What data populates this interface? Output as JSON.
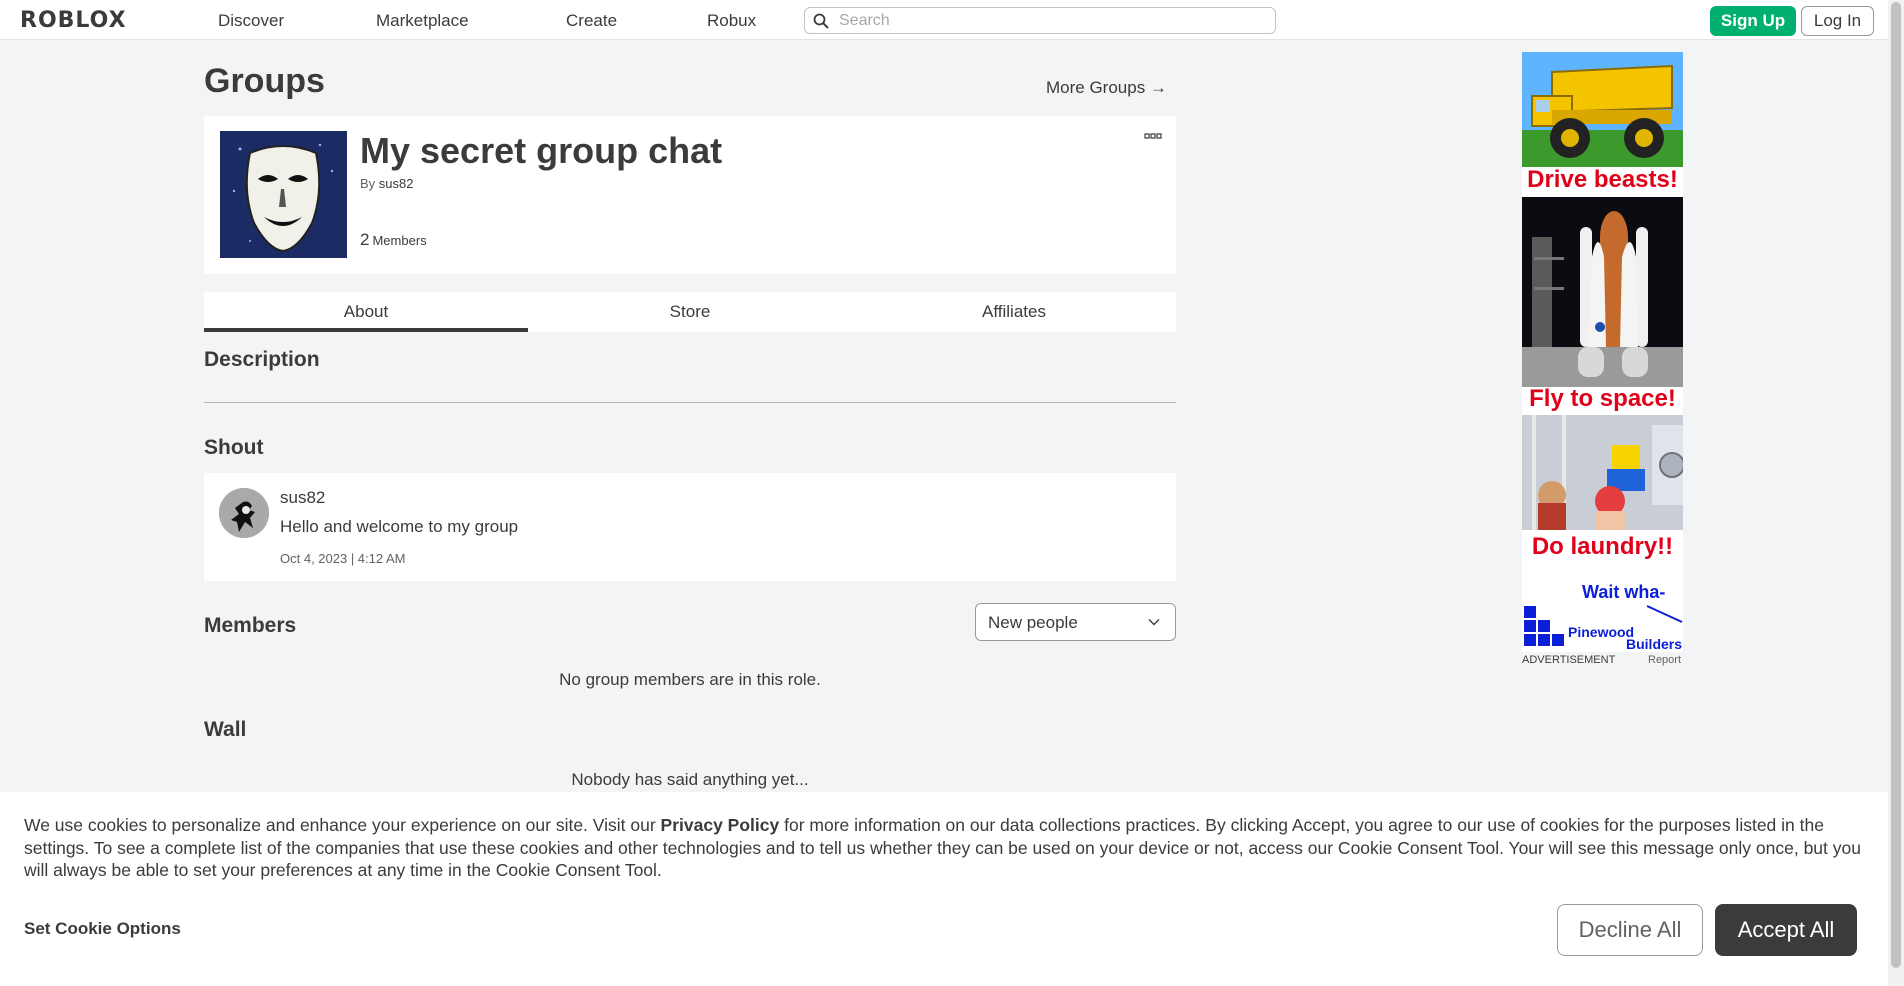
{
  "nav": {
    "logo": "ROBLOX",
    "links": [
      "Discover",
      "Marketplace",
      "Create",
      "Robux"
    ],
    "search_placeholder": "Search",
    "signup_label": "Sign Up",
    "login_label": "Log In"
  },
  "page": {
    "title": "Groups",
    "more_groups": "More Groups →"
  },
  "group": {
    "name": "My secret group chat",
    "by_prefix": "By",
    "owner": "sus82",
    "member_count": "2",
    "member_label": "Members"
  },
  "tabs": [
    "About",
    "Store",
    "Affiliates"
  ],
  "sections": {
    "description": "Description",
    "shout": "Shout",
    "members": "Members",
    "wall": "Wall"
  },
  "shout": {
    "user": "sus82",
    "text": "Hello and welcome to my group",
    "time": "Oct 4, 2023 | 4:12 AM"
  },
  "members": {
    "role_selected": "New people",
    "empty": "No group members are in this role."
  },
  "wall": {
    "empty": "Nobody has said anything yet..."
  },
  "ad": {
    "captions": [
      "Drive beasts!",
      "Fly to space!",
      "Do laundry!!"
    ],
    "tagline": "Wait wha-",
    "brand_line1": "Pinewood",
    "brand_line2": "Builders",
    "label": "ADVERTISEMENT",
    "report": "Report"
  },
  "cookie": {
    "text_before": "We use cookies to personalize and enhance your experience on our site. Visit our ",
    "policy_link": "Privacy Policy",
    "text_after": " for more information on our data collections practices. By clicking Accept, you agree to our use of cookies for the purposes listed in the settings. To see a complete list of the companies that use these cookies and other technologies and to tell us whether they can be used on your device or not, access our Cookie Consent Tool. Your will see this message only once, but you will always be able to set your preferences at any time in the Cookie Consent Tool.",
    "set_options": "Set Cookie Options",
    "decline": "Decline All",
    "accept": "Accept All"
  },
  "colors": {
    "signup_green": "#00b06f",
    "accept_dark": "#393b3d",
    "ad_red": "#e0001a",
    "ad_blue": "#0a1fd6"
  }
}
